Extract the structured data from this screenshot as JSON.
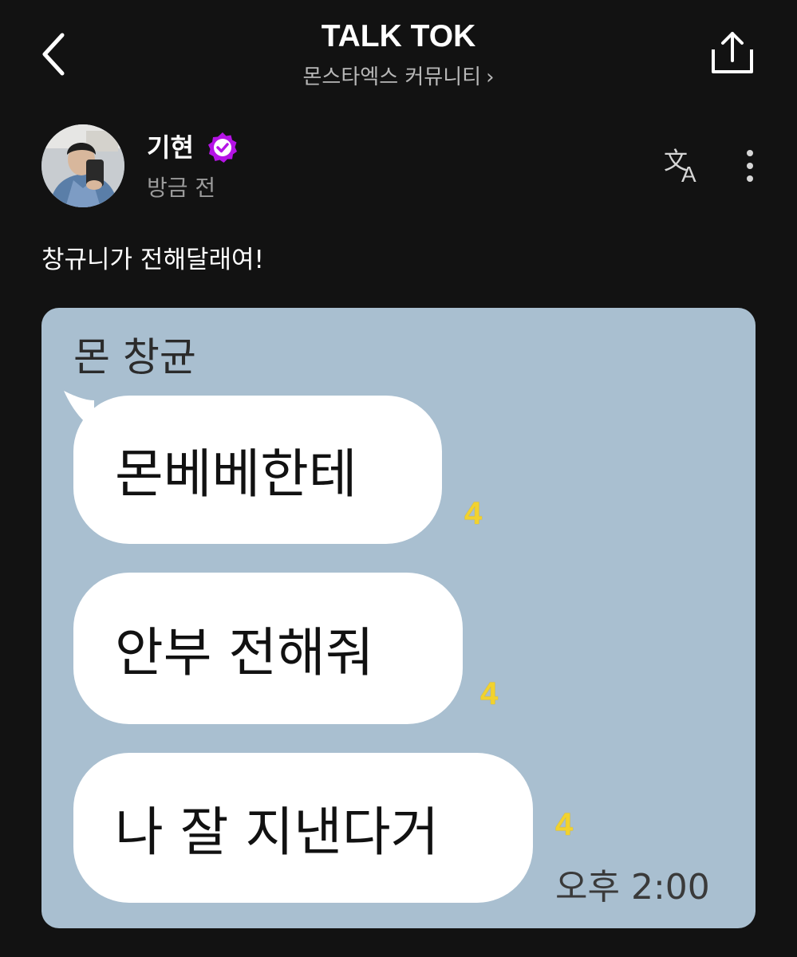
{
  "header": {
    "title": "TALK TOK",
    "subtitle": "몬스타엑스 커뮤니티",
    "subtitle_chevron": "›"
  },
  "post": {
    "author": "기현",
    "time": "방금 전",
    "text": "창규니가 전해달래여!"
  },
  "chat": {
    "sender": "몬 창균",
    "messages": [
      {
        "text": "몬베베한테",
        "unread": "4"
      },
      {
        "text": "안부 전해줘",
        "unread": "4"
      },
      {
        "text": "나 잘 지낸다거",
        "unread": "4"
      }
    ],
    "time": "오후 2:00"
  },
  "icons": {
    "back": "chevron-left-icon",
    "share": "share-upload-icon",
    "verified": "verified-badge-icon",
    "translate": "translate-icon",
    "more": "more-vertical-icon"
  },
  "colors": {
    "background": "#121212",
    "verified": "#b513e6",
    "chat_background": "#a9bfd0",
    "bubble": "#ffffff",
    "unread": "#f2d22e"
  }
}
